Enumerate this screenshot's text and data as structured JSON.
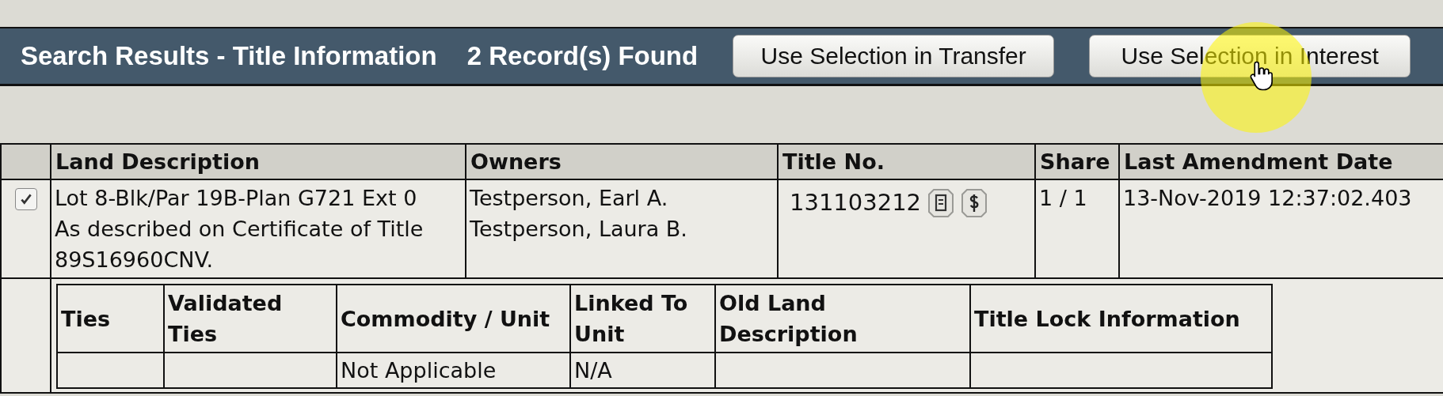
{
  "header": {
    "title": "Search Results - Title Information",
    "count": "2 Record(s) Found"
  },
  "buttons": [
    "Use Selection in Transfer",
    "Use Selection in Interest"
  ],
  "table": {
    "columns": [
      "Land Description",
      "Owners",
      "Title No.",
      "Share",
      "Last Amendment Date"
    ],
    "rows": [
      {
        "checked": true,
        "land_description": [
          "Lot 8-Blk/Par 19B-Plan G721 Ext 0",
          "As described on Certificate of Title 89S16960CNV."
        ],
        "owners": [
          "Testperson, Earl A.",
          "Testperson, Laura B."
        ],
        "title_no": "131103212",
        "share": "1 / 1",
        "last_amendment_date": "13-Nov-2019 12:37:02.403",
        "details": {
          "columns": [
            "Ties",
            "Validated Ties",
            "Commodity / Unit",
            "Linked To Unit",
            "Old Land Description",
            "Title Lock Information"
          ],
          "rows": [
            {
              "commodity_unit": "Not Applicable",
              "linked_to_unit": "N/A"
            }
          ]
        }
      }
    ]
  }
}
